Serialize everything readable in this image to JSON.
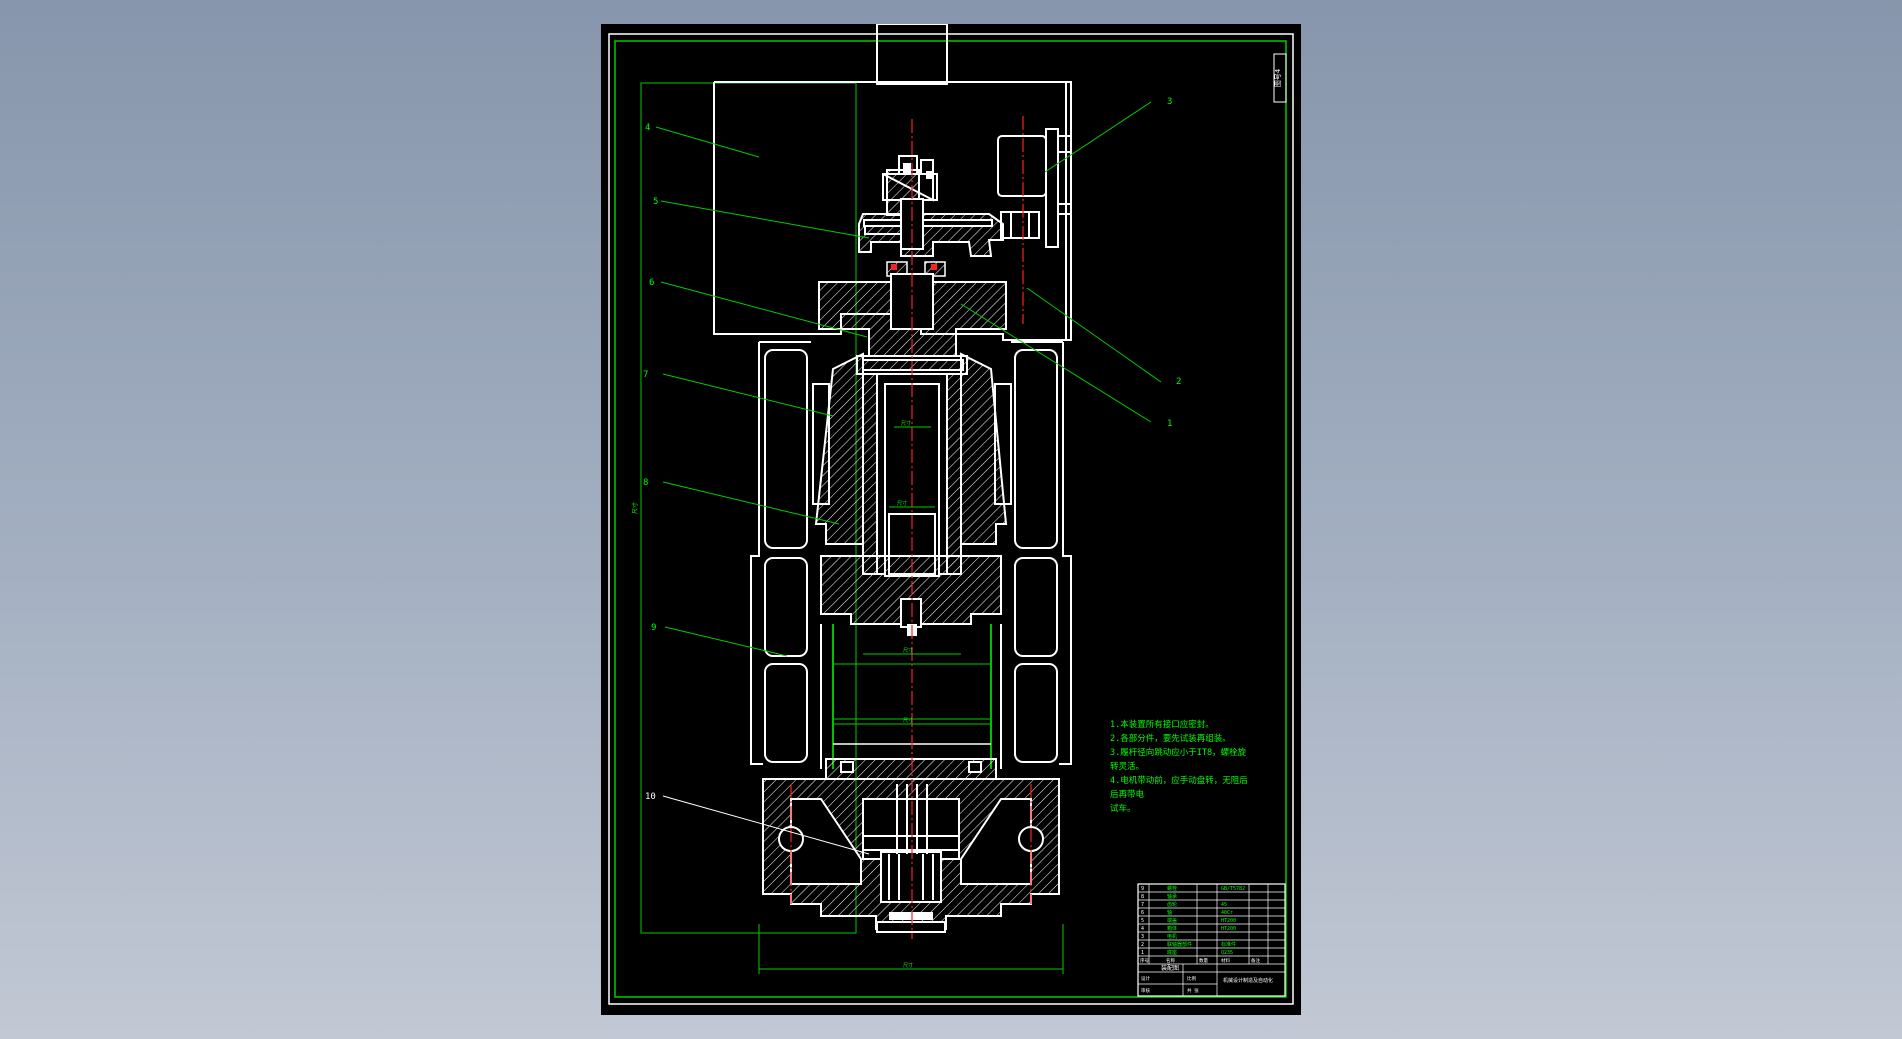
{
  "app": {
    "background_color": "#8f9cb1",
    "canvas_color": "#000000"
  },
  "drawing": {
    "sheet_code": "图号4",
    "part_labels": [
      "1",
      "2",
      "3",
      "4",
      "5",
      "6",
      "7",
      "8",
      "9",
      "10"
    ],
    "dimensions": {
      "overall_height": "尺寸",
      "base_width": "尺寸",
      "bore_upper": "尺寸",
      "bore_lower": "尺寸",
      "piston": "尺寸",
      "cylinder": "尺寸"
    },
    "notes": [
      "1.本装置所有接口应密封。",
      "2.各部分件，要先试装再组装。",
      "3.履杆径向跳动应小于IT8，螺栓旋",
      "转灵活。",
      "4.电机带动前，应手动盘转，无阻后",
      "后再带电",
      "  试车。"
    ],
    "title_block": {
      "drawing_name": "装配图",
      "company": "机械设计制造及自动化",
      "bom_rows": [
        {
          "no": "9",
          "name": "螺栓",
          "spec": "GB/T5782"
        },
        {
          "no": "8",
          "name": "轴承",
          "spec": ""
        },
        {
          "no": "7",
          "name": "齿轮",
          "spec": "45"
        },
        {
          "no": "6",
          "name": "轴",
          "spec": "40Cr"
        },
        {
          "no": "5",
          "name": "端盖",
          "spec": "HT200"
        },
        {
          "no": "4",
          "name": "箱体",
          "spec": "HT200"
        },
        {
          "no": "3",
          "name": "电机",
          "spec": ""
        },
        {
          "no": "2",
          "name": "联轴器部件",
          "spec": "标准件"
        },
        {
          "no": "1",
          "name": "底座",
          "spec": "Q235"
        }
      ],
      "header_cells": [
        "序号",
        "名称",
        "数量",
        "材料",
        "备注"
      ],
      "sign_cells": [
        "设计",
        "审核",
        "比例",
        "共 张"
      ]
    },
    "colors": {
      "outline": "#ffffff",
      "border": "#ffffff",
      "frame": "#00cc00",
      "leader": "#00cc00",
      "text": "#00ff00",
      "center": "#ff2020",
      "title_line": "#00ffff",
      "hatch": "#ffffff"
    }
  }
}
